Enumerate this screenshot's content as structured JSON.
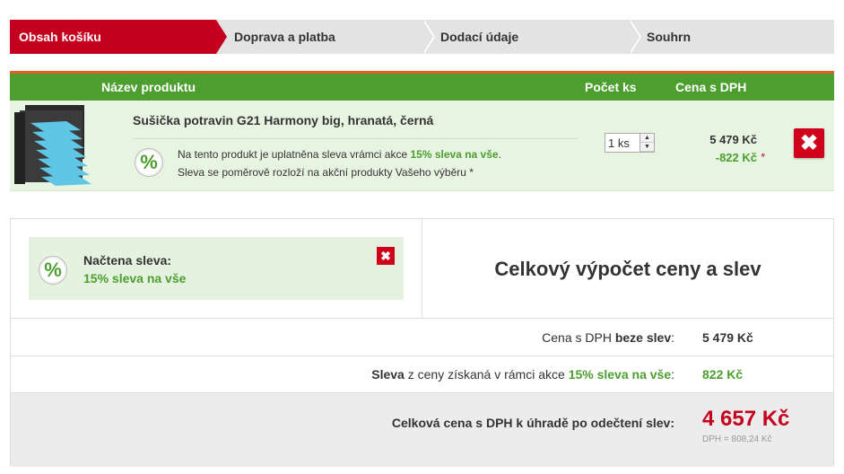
{
  "steps": [
    {
      "label": "Obsah košíku"
    },
    {
      "label": "Doprava a platba"
    },
    {
      "label": "Dodací údaje"
    },
    {
      "label": "Souhrn"
    }
  ],
  "cart": {
    "headers": {
      "product": "Název produktu",
      "qty": "Počet ks",
      "price": "Cena s DPH"
    },
    "item": {
      "name": "Sušička potravin G21 Harmony big, hranatá, černá",
      "discount_text_pre": "Na tento produkt je uplatněna sleva vrámci akce ",
      "discount_action": "15% sleva na vše",
      "discount_text_post": ".",
      "discount_note": "Sleva se poměrově rozloží na akční produkty Vašeho výběru *",
      "qty_value": "1 ks",
      "price": "5 479 Kč",
      "discount_price": "-822 Kč",
      "asterisk": "*",
      "delete_symbol": "✖"
    }
  },
  "coupon": {
    "title": "Načtena sleva:",
    "name": "15% sleva na vše",
    "remove_symbol": "✖"
  },
  "summary": {
    "title": "Celkový výpočet ceny a slev",
    "row1": {
      "label_pre": "Cena s DPH ",
      "label_bold": "beze slev",
      "label_post": ":",
      "value": "5 479 Kč"
    },
    "row2": {
      "label_bold": "Sleva",
      "label_mid": " z ceny získaná v rámci akce ",
      "label_action": "15% sleva na vše",
      "label_post": ":",
      "value": "822 Kč"
    },
    "row3": {
      "label": "Celková cena s DPH k úhradě po odečtení slev:",
      "total": "4 657 Kč",
      "vat": "DPH = 808,24 Kč"
    }
  },
  "icons": {
    "percent_badge": "percent-icon"
  }
}
